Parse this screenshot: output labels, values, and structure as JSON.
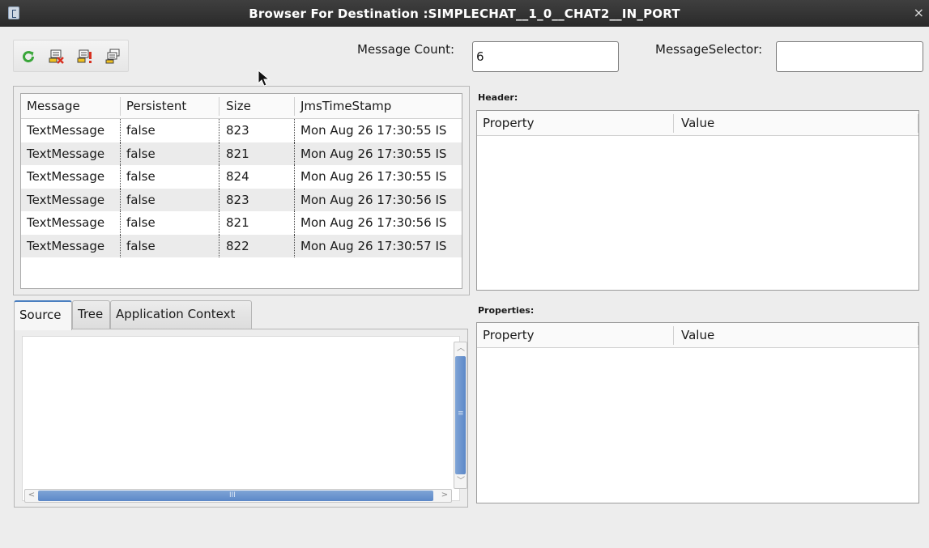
{
  "window": {
    "title": "Browser For Destination :SIMPLECHAT__1_0__CHAT2__IN_PORT",
    "close_glyph": "×"
  },
  "toolbar": {
    "icons": [
      "refresh-icon",
      "delete-messages-icon",
      "message-alert-icon",
      "copy-messages-icon"
    ]
  },
  "message_count": {
    "label": "Message Count:",
    "value": "6"
  },
  "message_selector": {
    "label": "MessageSelector:",
    "value": ""
  },
  "messages_table": {
    "columns": [
      "Message",
      "Persistent",
      "Size",
      "JmsTimeStamp"
    ],
    "rows": [
      [
        "TextMessage",
        "false",
        "823",
        "Mon Aug 26 17:30:55 IS"
      ],
      [
        "TextMessage",
        "false",
        "821",
        "Mon Aug 26 17:30:55 IS"
      ],
      [
        "TextMessage",
        "false",
        "824",
        "Mon Aug 26 17:30:55 IS"
      ],
      [
        "TextMessage",
        "false",
        "823",
        "Mon Aug 26 17:30:56 IS"
      ],
      [
        "TextMessage",
        "false",
        "821",
        "Mon Aug 26 17:30:56 IS"
      ],
      [
        "TextMessage",
        "false",
        "822",
        "Mon Aug 26 17:30:57 IS"
      ]
    ]
  },
  "tabs": {
    "items": [
      "Source",
      "Tree",
      "Application Context"
    ],
    "active": "Source"
  },
  "header_section": {
    "title": "Header:",
    "columns": [
      "Property",
      "Value"
    ]
  },
  "properties_section": {
    "title": "Properties:",
    "columns": [
      "Property",
      "Value"
    ]
  },
  "scrollbar": {
    "grip_v": "≡",
    "grip_h": "III"
  },
  "colors": {
    "title_bar": "#2f2f2f",
    "scroll_thumb": "#6a93cf",
    "tab_accent": "#4a7fc0",
    "refresh_green": "#3aa63a"
  }
}
